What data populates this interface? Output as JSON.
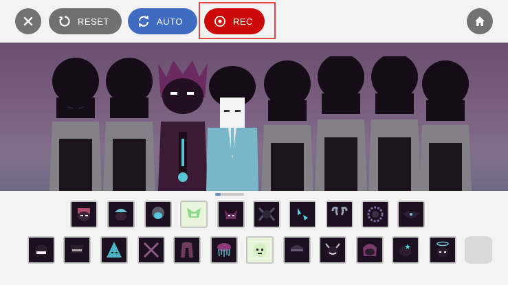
{
  "toolbar": {
    "reset_label": "RESET",
    "auto_label": "AUTO",
    "rec_label": "REC"
  },
  "colors": {
    "reset": "#707070",
    "auto": "#3f6bc1",
    "rec": "#cc0a0a",
    "highlight": "#e64646",
    "stage_top": "#6a4f70",
    "stage_bottom": "#8a7c97"
  },
  "icons": {
    "close": "close-icon",
    "reset": "reset-icon",
    "auto": "auto-icon",
    "rec": "record-icon",
    "home": "home-icon"
  },
  "stage": {
    "characters": [
      "shadow-singer-1",
      "shadow-singer-2",
      "horned-singer",
      "cyan-suit-singer",
      "shadow-singer-5",
      "shadow-singer-6",
      "shadow-singer-7",
      "shadow-singer-8"
    ]
  },
  "sound_icons": {
    "row1": [
      "hat-face",
      "tuft-face",
      "helmet-face",
      "leaf-face",
      "horn-face",
      "beetle-face",
      "crystals",
      "ram-horns",
      "spiky-halo",
      "bat-wings"
    ],
    "row2": [
      "bandana-face",
      "visor-face",
      "cone-face",
      "crossed-blades",
      "long-hair",
      "dripping-crown",
      "pale-face",
      "cap-face",
      "horned-grin",
      "frown-face",
      "star-face",
      "halo-face",
      "empty-slot"
    ]
  }
}
